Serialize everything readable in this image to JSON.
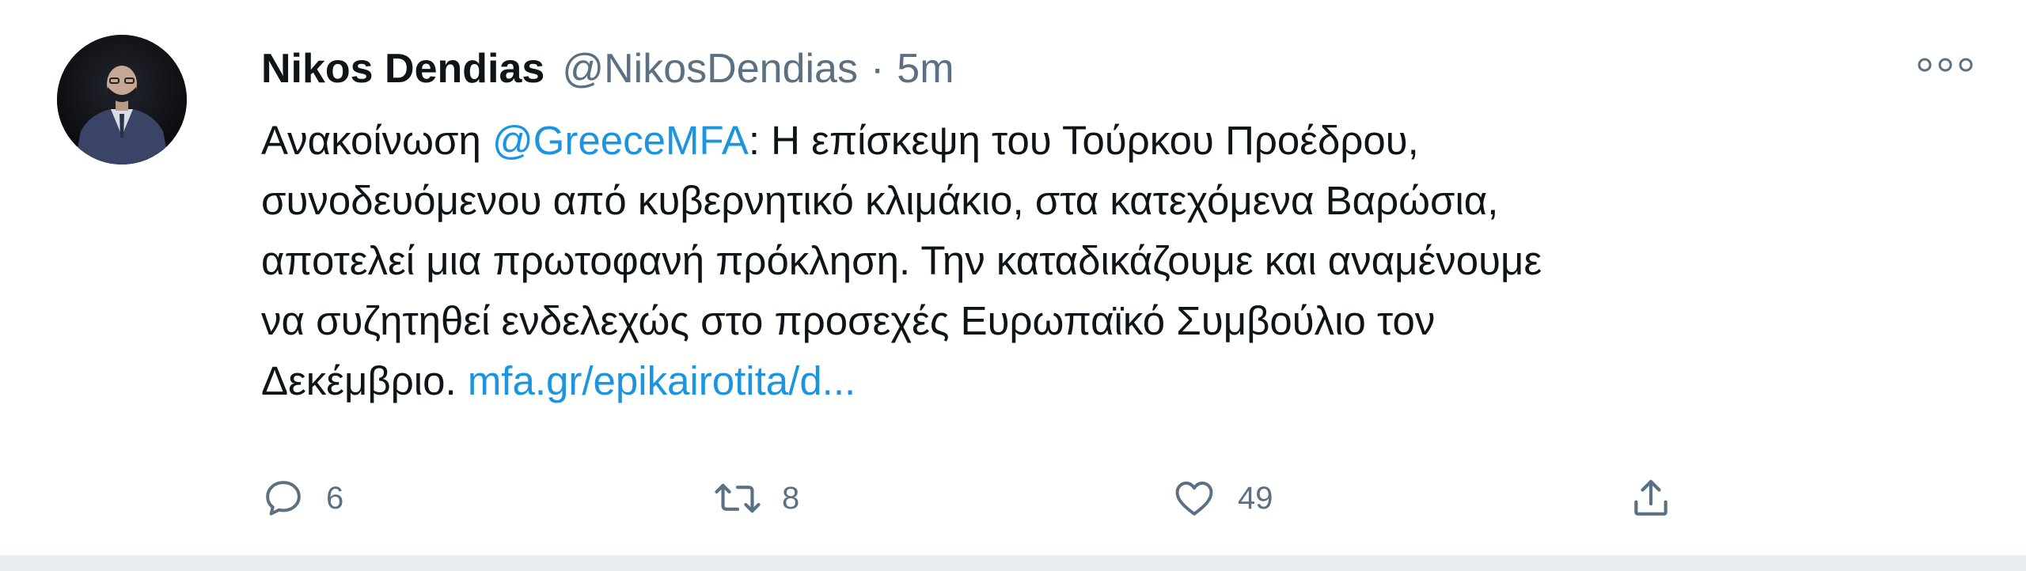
{
  "tweet": {
    "author": {
      "display_name": "Nikos Dendias",
      "handle": "@NikosDendias",
      "separator": "·",
      "time": "5m"
    },
    "more_icon": "more-horizontal-icon",
    "body": {
      "line1_prefix": "Ανακοίνωση ",
      "mention": "@GreeceMFA",
      "line1_suffix": ": Η επίσκεψη του Τούρκου Προέδρου,",
      "line2": "συνοδευόμενου από κυβερνητικό κλιμάκιο, στα κατεχόμενα Βαρώσια,",
      "line3": "αποτελεί μια πρωτοφανή πρόκληση. Την καταδικάζουμε και αναμένουμε",
      "line4": "να συζητηθεί ενδελεχώς στο προσεχές Ευρωπαϊκό Συμβούλιο τον",
      "line5_prefix": "Δεκέμβριο. ",
      "link": "mfa.gr/epikairotita/d..."
    },
    "actions": {
      "reply": {
        "icon": "reply-icon",
        "count": "6"
      },
      "retweet": {
        "icon": "retweet-icon",
        "count": "8"
      },
      "like": {
        "icon": "heart-icon",
        "count": "49"
      },
      "share": {
        "icon": "share-icon"
      }
    }
  },
  "colors": {
    "text": "#0f1419",
    "muted": "#5b7083",
    "link": "#1b95e0",
    "background": "#ffffff",
    "divider": "#e9edf0"
  }
}
